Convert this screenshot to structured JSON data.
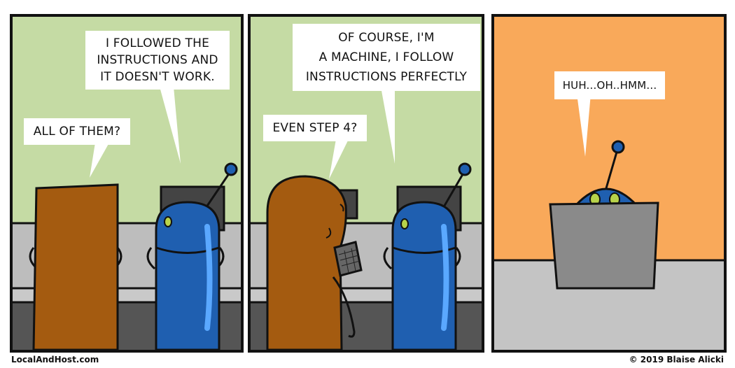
{
  "panels": [
    {
      "bubbles": [
        {
          "text": "I FOLLOWED THE\nINSTRUCTIONS AND\nIT DOESN'T WORK."
        },
        {
          "text": "ALL OF THEM?"
        }
      ]
    },
    {
      "bubbles": [
        {
          "text": "OF COURSE, I'M\nA MACHINE, I FOLLOW\nINSTRUCTIONS PERFECTLY"
        },
        {
          "text": "EVEN STEP 4?"
        }
      ]
    },
    {
      "bubbles": [
        {
          "text": "HUH...OH..HMM..."
        }
      ]
    }
  ],
  "footer": {
    "site": "LocalAndHost.com",
    "credit": "© 2019 Blaise Alicki"
  },
  "colors": {
    "wall_green": "#c5dba4",
    "wall_orange": "#f9a95a",
    "desk_gray": "#bdbdbd",
    "floor_dark": "#555555",
    "robot_blue": "#1f5fb0",
    "person_brown": "#a45b10"
  }
}
